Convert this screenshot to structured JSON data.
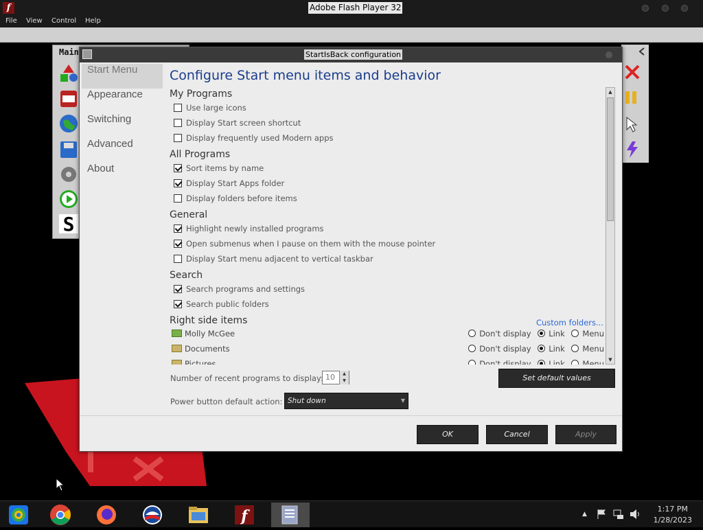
{
  "flash_window": {
    "title": "Adobe Flash Player 32",
    "menu": [
      "File",
      "View",
      "Control",
      "Help"
    ]
  },
  "background_panel": {
    "title": "Main"
  },
  "dialog": {
    "title": "StartIsBack configuration",
    "nav": [
      "Start Menu",
      "Appearance",
      "Switching",
      "Advanced",
      "About"
    ],
    "active_nav": "Start Menu",
    "heading": "Configure Start menu items and behavior",
    "sections": {
      "my_programs": {
        "title": "My Programs",
        "options": [
          {
            "label": "Use large icons",
            "checked": false
          },
          {
            "label": "Display Start screen shortcut",
            "checked": false
          },
          {
            "label": "Display frequently used Modern apps",
            "checked": false
          }
        ]
      },
      "all_programs": {
        "title": "All Programs",
        "options": [
          {
            "label": "Sort items by name",
            "checked": true
          },
          {
            "label": "Display Start Apps folder",
            "checked": true
          },
          {
            "label": "Display folders before items",
            "checked": false
          }
        ]
      },
      "general": {
        "title": "General",
        "options": [
          {
            "label": "Highlight newly installed programs",
            "checked": true
          },
          {
            "label": "Open submenus when I pause on them with the mouse pointer",
            "checked": true
          },
          {
            "label": "Display Start menu adjacent to vertical taskbar",
            "checked": false
          }
        ]
      },
      "search": {
        "title": "Search",
        "options": [
          {
            "label": "Search programs and settings",
            "checked": true
          },
          {
            "label": "Search public folders",
            "checked": true
          }
        ]
      },
      "right_side": {
        "title": "Right side items",
        "custom_link": "Custom folders...",
        "radio_labels": [
          "Don't display",
          "Link",
          "Menu"
        ],
        "items": [
          {
            "name": "Molly McGee",
            "selected": "Link"
          },
          {
            "name": "Documents",
            "selected": "Link"
          },
          {
            "name": "Pictures",
            "selected": "Link"
          }
        ]
      }
    },
    "recent_programs_label": "Number of recent programs to display:",
    "recent_programs_value": "10",
    "power_label": "Power button default action:",
    "power_value": "Shut down",
    "default_button": "Set default values",
    "ok_button": "OK",
    "cancel_button": "Cancel",
    "apply_button": "Apply"
  },
  "taskbar": {
    "time": "1:17 PM",
    "date": "1/28/2023"
  },
  "colors": {
    "heading": "#1a3c8c",
    "link": "#2a6ad8",
    "flash_red": "#7c1212",
    "stage_red": "#c8141e"
  }
}
